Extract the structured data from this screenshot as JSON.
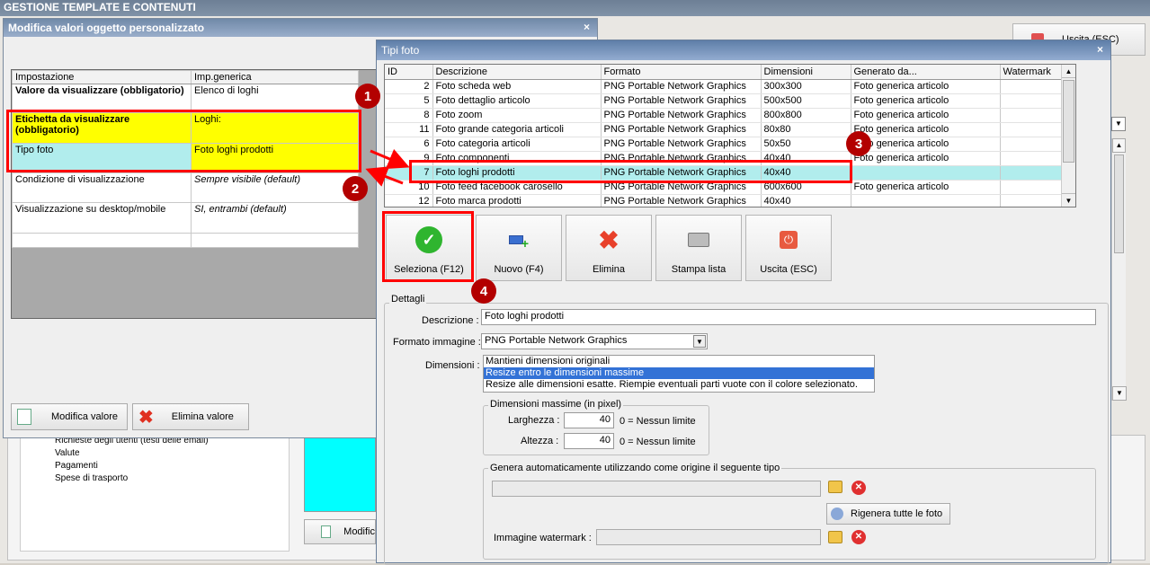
{
  "main": {
    "title": "GESTIONE TEMPLATE E CONTENUTI",
    "exit_button": "Uscita (ESC)",
    "edit_button_partial": "Modific"
  },
  "tree": {
    "items": [
      "Richieste degli utenti (testi delle email)",
      "Valute",
      "Pagamenti",
      "Spese di trasporto"
    ]
  },
  "dialog1": {
    "title": "Modifica valori oggetto personalizzato",
    "close": "×",
    "columns": [
      "Impostazione",
      "Imp.generica"
    ],
    "rows": [
      {
        "setting": "Valore da visualizzare (obbligatorio)",
        "value": "Elenco di loghi"
      },
      {
        "setting": "Etichetta da visualizzare (obbligatorio)",
        "value": "Loghi:"
      },
      {
        "setting": "Tipo foto",
        "value": "Foto loghi prodotti"
      },
      {
        "setting": "Condizione di visualizzazione",
        "value": "Sempre visibile (default)"
      },
      {
        "setting": "Visualizzazione su desktop/mobile",
        "value": "SI, entrambi (default)"
      }
    ],
    "edit_button": "Modifica valore",
    "delete_button": "Elimina valore"
  },
  "dialog2": {
    "title": "Tipi foto",
    "close": "×",
    "columns": [
      "ID",
      "Descrizione",
      "Formato",
      "Dimensioni",
      "Generato da...",
      "Watermark"
    ],
    "rows": [
      {
        "id": "2",
        "desc": "Foto scheda web",
        "format": "PNG Portable Network Graphics",
        "dim": "300x300",
        "gen": "Foto generica articolo",
        "wm": ""
      },
      {
        "id": "5",
        "desc": "Foto dettaglio articolo",
        "format": "PNG Portable Network Graphics",
        "dim": "500x500",
        "gen": "Foto generica articolo",
        "wm": ""
      },
      {
        "id": "8",
        "desc": "Foto zoom",
        "format": "PNG Portable Network Graphics",
        "dim": "800x800",
        "gen": "Foto generica articolo",
        "wm": ""
      },
      {
        "id": "11",
        "desc": "Foto grande categoria articoli",
        "format": "PNG Portable Network Graphics",
        "dim": "80x80",
        "gen": "Foto generica articolo",
        "wm": ""
      },
      {
        "id": "6",
        "desc": "Foto categoria articoli",
        "format": "PNG Portable Network Graphics",
        "dim": "50x50",
        "gen": "Foto generica articolo",
        "wm": ""
      },
      {
        "id": "9",
        "desc": "Foto componenti",
        "format": "PNG Portable Network Graphics",
        "dim": "40x40",
        "gen": "Foto generica articolo",
        "wm": ""
      },
      {
        "id": "7",
        "desc": "Foto loghi prodotti",
        "format": "PNG Portable Network Graphics",
        "dim": "40x40",
        "gen": "",
        "wm": ""
      },
      {
        "id": "10",
        "desc": "Foto feed facebook carosello",
        "format": "PNG Portable Network Graphics",
        "dim": "600x600",
        "gen": "Foto generica articolo",
        "wm": ""
      },
      {
        "id": "12",
        "desc": "Foto marca prodotti",
        "format": "PNG Portable Network Graphics",
        "dim": "40x40",
        "gen": "",
        "wm": ""
      }
    ],
    "buttons": {
      "select": "Seleziona (F12)",
      "new": "Nuovo (F4)",
      "delete": "Elimina",
      "print": "Stampa lista",
      "exit": "Uscita (ESC)"
    },
    "details": {
      "legend": "Dettagli",
      "desc_label": "Descrizione :",
      "desc_value": "Foto loghi prodotti",
      "format_label": "Formato immagine :",
      "format_value": "PNG Portable Network Graphics",
      "dim_label": "Dimensioni :",
      "dim_options": [
        "Mantieni dimensioni originali",
        "Resize entro le dimensioni massime",
        "Resize alle dimensioni esatte. Riempie eventuali parti vuote con il colore selezionato."
      ],
      "max_legend": "Dimensioni massime (in pixel)",
      "width_label": "Larghezza :",
      "width_value": "40",
      "height_label": "Altezza :",
      "height_value": "40",
      "no_limit": "0 = Nessun limite",
      "auto_legend": "Genera automaticamente utilizzando come origine il seguente tipo",
      "regen_button": "Rigenera tutte le foto",
      "watermark_label": "Immagine watermark :"
    }
  },
  "markers": [
    "1",
    "2",
    "3",
    "4"
  ],
  "colors": {
    "highlight_yellow": "#ffff00",
    "selected_cyan": "#b1eded",
    "annotation_red": "#ff0000",
    "marker_dark_red": "#b30000"
  }
}
